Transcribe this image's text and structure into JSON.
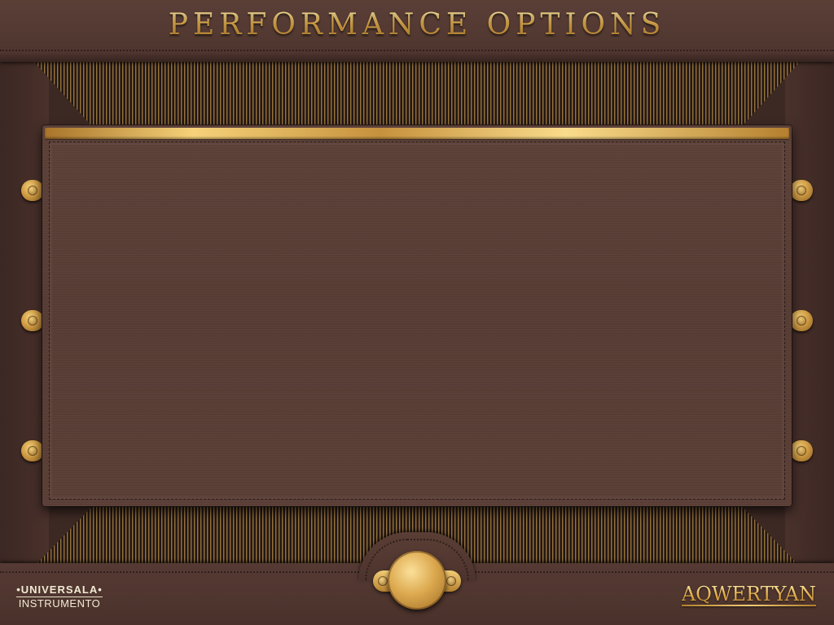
{
  "header": {
    "title": "PERFORMANCE OPTIONS"
  },
  "footer": {
    "left_brand_line1": "•UNIVERSALA•",
    "left_brand_line2": "INSTRUMENTO",
    "right_brand": "AQWERTYAN"
  },
  "colors": {
    "wood": "#5a3f37",
    "gold": "#e6b04e",
    "dark_frame": "#3d2924"
  },
  "icons": {
    "brackets": "gold-screw-bracket-icon",
    "medallion": "gold-medallion-icon"
  }
}
